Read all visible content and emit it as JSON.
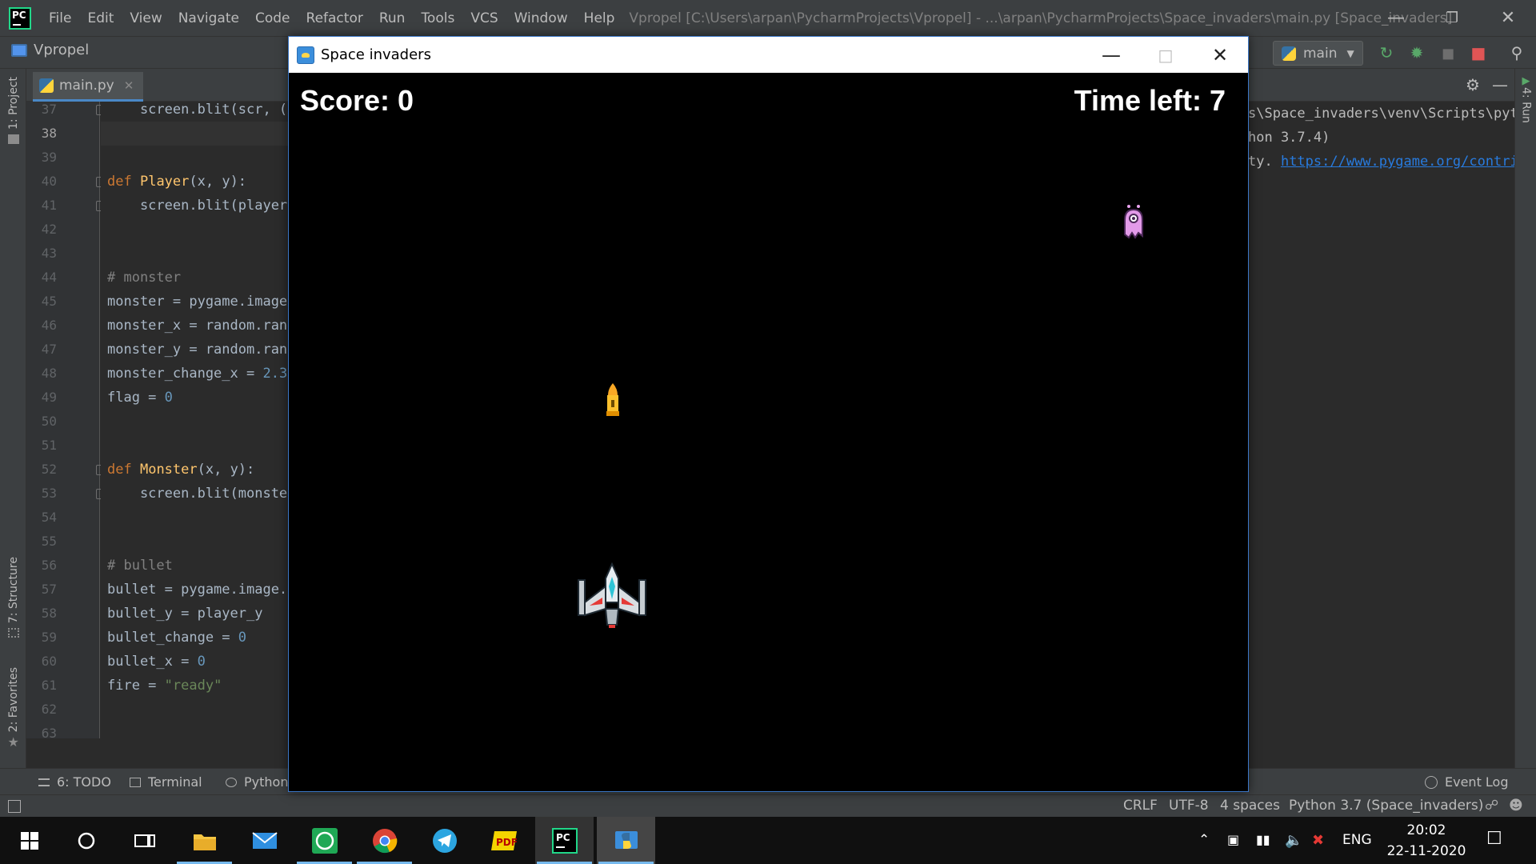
{
  "ide": {
    "menu": [
      "File",
      "Edit",
      "View",
      "Navigate",
      "Code",
      "Refactor",
      "Run",
      "Tools",
      "VCS",
      "Window",
      "Help"
    ],
    "title_path": "Vpropel [C:\\Users\\arpan\\PycharmProjects\\Vpropel] - ...\\arpan\\PycharmProjects\\Space_invaders\\main.py [Space_invaders]",
    "project_name": "Vpropel",
    "run_config": "main",
    "editor_tab": "main.py",
    "left_tabs": {
      "project": "1: Project",
      "structure": "7: Structure",
      "favorites": "2: Favorites"
    },
    "right_tab": "4: Run"
  },
  "editor": {
    "lines": [
      {
        "no": "37",
        "text": "    screen.blit(scr, (x"
      },
      {
        "no": "38",
        "text": ""
      },
      {
        "no": "39",
        "text": ""
      },
      {
        "no": "40",
        "text": "def Player(x, y):"
      },
      {
        "no": "41",
        "text": "    screen.blit(player,"
      },
      {
        "no": "42",
        "text": ""
      },
      {
        "no": "43",
        "text": ""
      },
      {
        "no": "44",
        "text": "# monster"
      },
      {
        "no": "45",
        "text": "monster = pygame.image."
      },
      {
        "no": "46",
        "text": "monster_x = random.ranc"
      },
      {
        "no": "47",
        "text": "monster_y = random.ranc"
      },
      {
        "no": "48",
        "text": "monster_change_x = 2.3"
      },
      {
        "no": "49",
        "text": "flag = 0"
      },
      {
        "no": "50",
        "text": ""
      },
      {
        "no": "51",
        "text": ""
      },
      {
        "no": "52",
        "text": "def Monster(x, y):"
      },
      {
        "no": "53",
        "text": "    screen.blit(monster"
      },
      {
        "no": "54",
        "text": ""
      },
      {
        "no": "55",
        "text": ""
      },
      {
        "no": "56",
        "text": "# bullet"
      },
      {
        "no": "57",
        "text": "bullet = pygame.image.l"
      },
      {
        "no": "58",
        "text": "bullet_y = player_y"
      },
      {
        "no": "59",
        "text": "bullet_change = 0"
      },
      {
        "no": "60",
        "text": "bullet_x = 0"
      },
      {
        "no": "61",
        "text": "fire = \"ready\""
      },
      {
        "no": "62",
        "text": ""
      },
      {
        "no": "63",
        "text": ""
      }
    ],
    "current_line": "38"
  },
  "console": {
    "line1": "s\\Space_invaders\\venv\\Scripts\\pyt",
    "line2": "hon 3.7.4)",
    "line3_prefix": "ty. ",
    "line3_link": "https://www.pygame.org/contri"
  },
  "bottom_tools": {
    "todo": "6: TODO",
    "terminal": "Terminal",
    "python": "Python",
    "event_log": "Event Log"
  },
  "status": {
    "line_sep": "CRLF",
    "encoding": "UTF-8",
    "indent": "4 spaces",
    "interpreter": "Python 3.7 (Space_invaders)"
  },
  "game": {
    "window_title": "Space invaders",
    "score_text": "Score: 0",
    "time_text": "Time left: 7"
  },
  "taskbar": {
    "language": "ENG",
    "time": "20:02",
    "date": "22-11-2020"
  },
  "colors": {
    "ide_bg": "#2b2b2b",
    "accent": "#4a88c7",
    "game_bg": "#000000"
  }
}
